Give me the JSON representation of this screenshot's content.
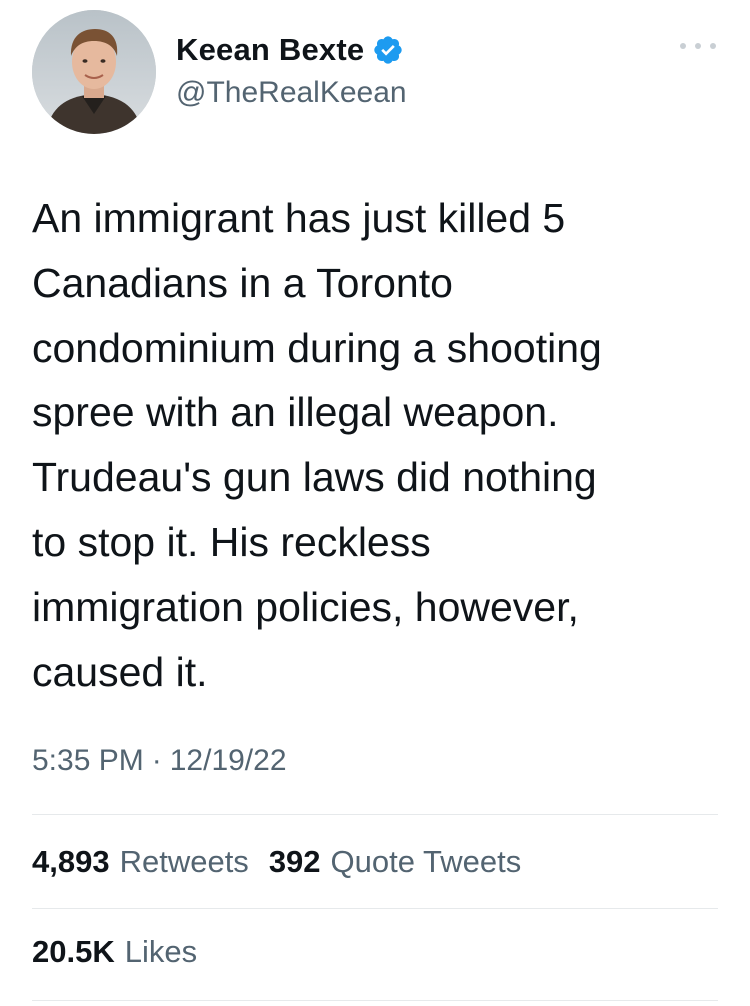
{
  "author": {
    "display_name": "Keean Bexte",
    "handle": "@TheRealKeean",
    "verified": true,
    "avatar_icon": "profile-photo"
  },
  "tweet": {
    "text": "An immigrant has just killed 5\nCanadians in a Toronto\ncondominium during a shooting\nspree with an illegal weapon.\nTrudeau's gun laws did nothing\nto stop it. His reckless\nimmigration policies, however,\ncaused it.",
    "time": "5:35 PM",
    "separator": "·",
    "date": "12/19/22"
  },
  "stats": {
    "retweets_count": "4,893",
    "retweets_label": "Retweets",
    "quote_tweets_count": "392",
    "quote_tweets_label": "Quote Tweets",
    "likes_count": "20.5K",
    "likes_label": "Likes"
  },
  "colors": {
    "text_primary": "#0f1419",
    "text_secondary": "#536471",
    "verified_blue": "#1d9bf0",
    "divider": "#e6e9eb"
  },
  "icons": {
    "more": "more-icon",
    "verified": "verified-badge-icon"
  }
}
